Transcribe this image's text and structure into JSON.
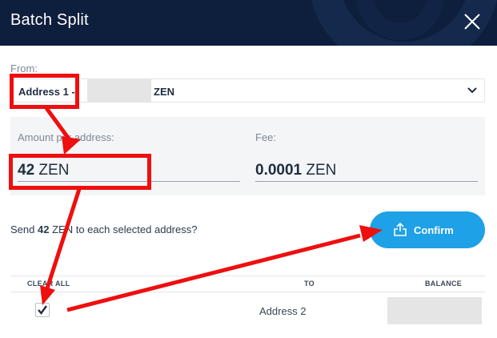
{
  "header": {
    "title": "Batch Split"
  },
  "from": {
    "label": "From:",
    "address_label": "Address 1 -",
    "coin": "ZEN"
  },
  "amount": {
    "label": "Amount per address:",
    "value": "42",
    "unit": "ZEN"
  },
  "fee": {
    "label": "Fee:",
    "value": "0.0001",
    "unit": "ZEN"
  },
  "summary": {
    "prefix": "Send",
    "amount": "42",
    "suffix": "ZEN to each selected address?"
  },
  "confirm": {
    "label": "Confirm"
  },
  "table": {
    "headers": [
      "CLEAR ALL",
      "TO",
      "BALANCE"
    ],
    "rows": [
      {
        "to": "Address 2",
        "checked": true
      }
    ]
  },
  "colors": {
    "header_bg": "#0e1e3d",
    "accent": "#1ea1e6",
    "annotation": "#ee0f0f"
  },
  "icons": [
    "close-icon",
    "chevron-down-icon",
    "upload-icon",
    "checkmark-icon"
  ]
}
